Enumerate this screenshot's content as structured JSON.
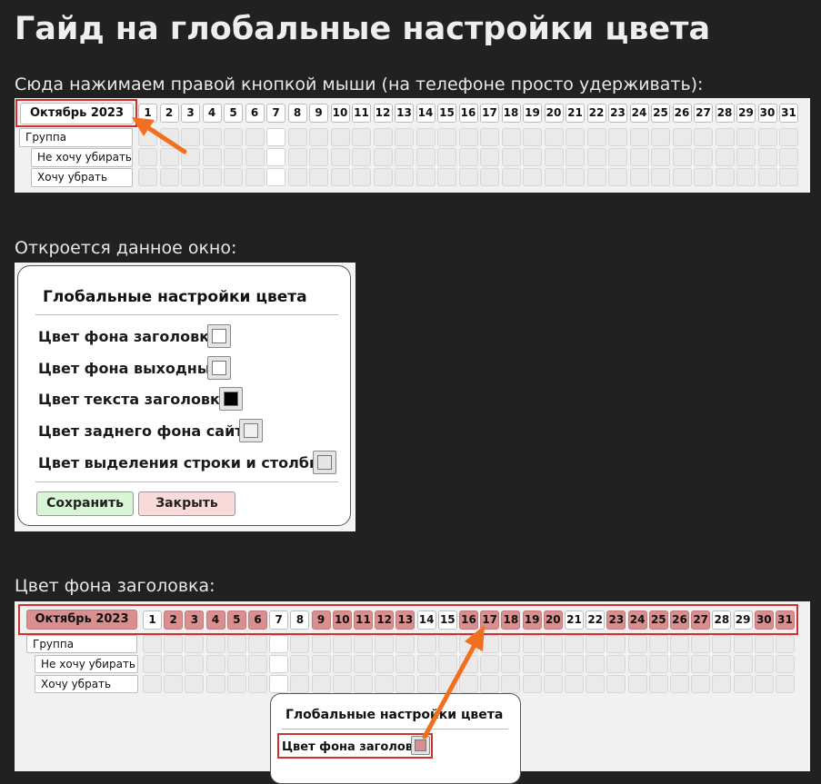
{
  "title": "Гайд на глобальные настройки цвета",
  "section1": {
    "caption": "Сюда нажимаем правой кнопкой мыши (на телефоне просто удерживать):",
    "month": "Октябрь 2023",
    "days": [
      "1",
      "2",
      "3",
      "4",
      "5",
      "6",
      "7",
      "8",
      "9",
      "10",
      "11",
      "12",
      "13",
      "14",
      "15",
      "16",
      "17",
      "18",
      "19",
      "20",
      "21",
      "22",
      "23",
      "24",
      "25",
      "26",
      "27",
      "28",
      "29",
      "30",
      "31"
    ],
    "rows": [
      "Группа",
      "Не хочу убирать",
      "Хочу убрать"
    ]
  },
  "section2": {
    "caption": "Откроется данное окно:",
    "dialog": {
      "title": "Глобальные настройки цвета",
      "rows": [
        {
          "label": "Цвет фона заголовка",
          "color": "#ffffff"
        },
        {
          "label": "Цвет фона выходных",
          "color": "#ffffff"
        },
        {
          "label": "Цвет текста заголовка",
          "color": "#000000"
        },
        {
          "label": "Цвет заднего фона сайта",
          "color": "#f1f1f1"
        },
        {
          "label": "Цвет выделения строки и столбца",
          "color": "#e6e6e6"
        }
      ],
      "save": "Сохранить",
      "close": "Закрыть"
    }
  },
  "section3": {
    "caption": "Цвет фона заголовка:",
    "month": "Октябрь 2023",
    "header_color": "#d98f8f",
    "weekend_days": [
      "1",
      "7",
      "8",
      "14",
      "15",
      "21",
      "22",
      "28",
      "29"
    ],
    "rows": [
      "Группа",
      "Не хочу убирать",
      "Хочу убрать"
    ],
    "dialog_title": "Глобальные настройки цвета",
    "dialog_row": "Цвет фона заголовка"
  },
  "colors": {
    "highlight": "#d32f2f",
    "arrow": "#f07020",
    "save_bg": "#d8f5d6",
    "close_bg": "#fbdada"
  }
}
